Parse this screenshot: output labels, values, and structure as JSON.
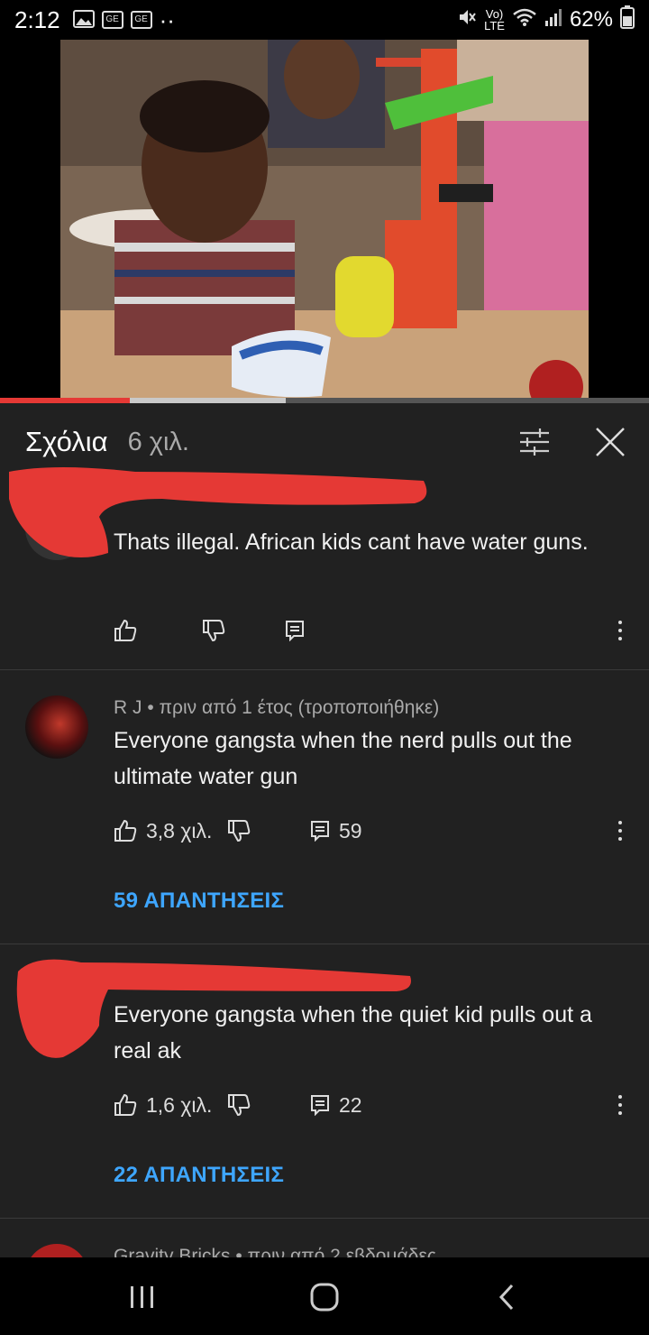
{
  "status_bar": {
    "time": "2:12",
    "notif_badge_1": "GE",
    "notif_badge_2": "GE",
    "more_dots": "··",
    "volte": "Vo)",
    "lte": "LTE",
    "battery": "62%"
  },
  "video": {
    "progress_fraction": 0.2,
    "buffer_fraction": 0.44
  },
  "comments_panel": {
    "title": "Σχόλια",
    "count": "6 χιλ.",
    "filter_icon": "sliders-icon",
    "close_icon": "close-icon"
  },
  "comments": [
    {
      "author_meta": "",
      "text": "Thats illegal. African kids cant have water guns.",
      "likes": "",
      "replies_count": "",
      "replies_link": ""
    },
    {
      "author_meta": "R J • πριν από 1 έτος (τροποποιήθηκε)",
      "text": "Everyone gangsta when the nerd pulls out the ultimate water gun",
      "likes": "3,8 χιλ.",
      "replies_count": "59",
      "replies_link": "59 ΑΠΑΝΤΗΣΕΙΣ"
    },
    {
      "author_meta": "",
      "text": "Everyone gangsta when the quiet kid pulls out a real ak",
      "likes": "1,6 χιλ.",
      "replies_count": "22",
      "replies_link": "22 ΑΠΑΝΤΗΣΕΙΣ"
    },
    {
      "author_meta": "Gravity Bricks • πριν από 2 εβδομάδες",
      "text": "",
      "likes": "",
      "replies_count": "",
      "replies_link": ""
    }
  ],
  "colors": {
    "background": "#212121",
    "accent_red": "#e53935",
    "link_blue": "#3ea6ff"
  }
}
